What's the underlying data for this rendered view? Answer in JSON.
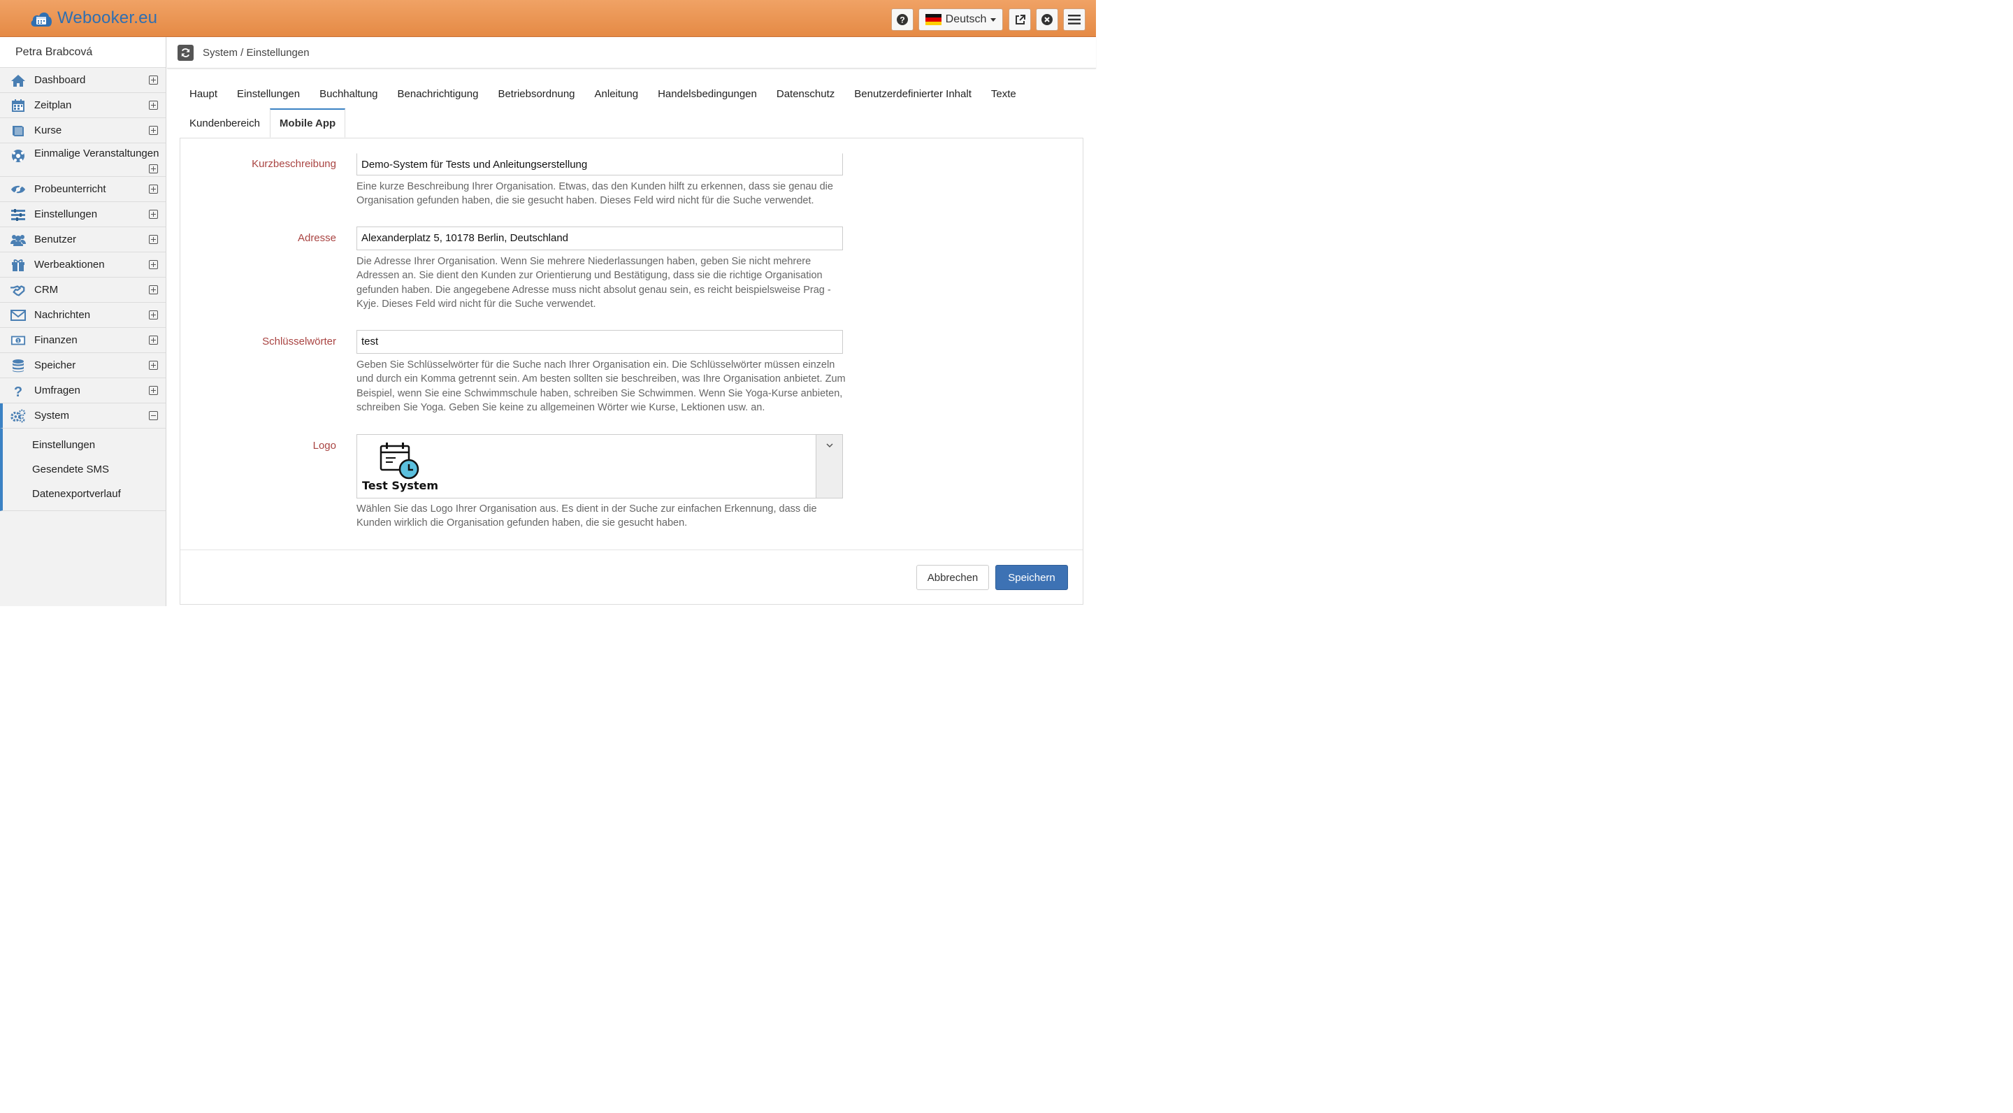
{
  "app": {
    "brand": "Webooker.eu",
    "accent_color": "#e58a45",
    "brand_color": "#2f6fb1",
    "primary_color": "#3d72b4"
  },
  "header": {
    "language": "Deutsch",
    "icons": [
      "help-icon",
      "external-link-icon",
      "close-circle-icon",
      "hamburger-menu-icon"
    ]
  },
  "sidebar": {
    "user": "Petra Brabcová",
    "items": [
      {
        "label": "Dashboard",
        "icon": "home-icon"
      },
      {
        "label": "Zeitplan",
        "icon": "calendar-icon"
      },
      {
        "label": "Kurse",
        "icon": "book-icon"
      },
      {
        "label": "Einmalige Veranstaltungen",
        "icon": "ball-icon"
      },
      {
        "label": "Probeunterricht",
        "icon": "eye-slash-icon"
      },
      {
        "label": "Einstellungen",
        "icon": "sliders-icon"
      },
      {
        "label": "Benutzer",
        "icon": "users-icon"
      },
      {
        "label": "Werbeaktionen",
        "icon": "gift-icon"
      },
      {
        "label": "CRM",
        "icon": "handshake-icon"
      },
      {
        "label": "Nachrichten",
        "icon": "envelope-icon"
      },
      {
        "label": "Finanzen",
        "icon": "money-icon"
      },
      {
        "label": "Speicher",
        "icon": "database-icon"
      },
      {
        "label": "Umfragen",
        "icon": "question-icon"
      },
      {
        "label": "System",
        "icon": "gears-icon"
      }
    ],
    "system_subitems": [
      "Einstellungen",
      "Gesendete SMS",
      "Datenexportverlauf"
    ]
  },
  "breadcrumb": "System / Einstellungen",
  "tabs": {
    "row1": [
      "Haupt",
      "Einstellungen",
      "Buchhaltung",
      "Benachrichtigung",
      "Betriebsordnung",
      "Anleitung",
      "Handelsbedingungen",
      "Datenschutz",
      "Benutzerdefinierter Inhalt",
      "Texte"
    ],
    "row2": [
      "Kundenbereich",
      "Mobile App"
    ],
    "active": "Mobile App"
  },
  "form": {
    "short_description": {
      "label": "Kurzbeschreibung",
      "value": "Demo-System für Tests und Anleitungserstellung",
      "help": "Eine kurze Beschreibung Ihrer Organisation. Etwas, das den Kunden hilft zu erkennen, dass sie genau die Organisation gefunden haben, die sie gesucht haben. Dieses Feld wird nicht für die Suche verwendet."
    },
    "address": {
      "label": "Adresse",
      "value": "Alexanderplatz 5, 10178 Berlin, Deutschland",
      "help": "Die Adresse Ihrer Organisation. Wenn Sie mehrere Niederlassungen haben, geben Sie nicht mehrere Adressen an. Sie dient den Kunden zur Orientierung und Bestätigung, dass sie die richtige Organisation gefunden haben. Die angegebene Adresse muss nicht absolut genau sein, es reicht beispielsweise Prag - Kyje. Dieses Feld wird nicht für die Suche verwendet."
    },
    "keywords": {
      "label": "Schlüsselwörter",
      "value": "test",
      "help": "Geben Sie Schlüsselwörter für die Suche nach Ihrer Organisation ein. Die Schlüsselwörter müssen einzeln und durch ein Komma getrennt sein. Am besten sollten sie beschreiben, was Ihre Organisation anbietet. Zum Beispiel, wenn Sie eine Schwimmschule haben, schreiben Sie Schwimmen. Wenn Sie Yoga-Kurse anbieten, schreiben Sie Yoga. Geben Sie keine zu allgemeinen Wörter wie Kurse, Lektionen usw. an."
    },
    "logo": {
      "label": "Logo",
      "caption": "Test System",
      "help": "Wählen Sie das Logo Ihrer Organisation aus. Es dient in der Suche zur einfachen Erkennung, dass die Kunden wirklich die Organisation gefunden haben, die sie gesucht haben."
    }
  },
  "buttons": {
    "cancel": "Abbrechen",
    "save": "Speichern"
  }
}
